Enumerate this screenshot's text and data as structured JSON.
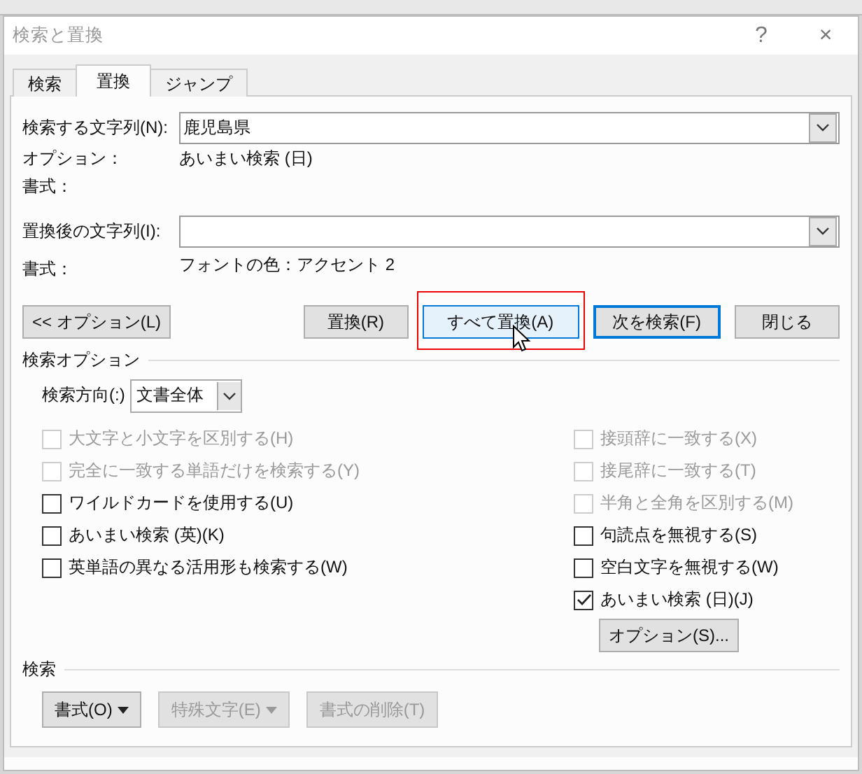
{
  "window": {
    "title": "検索と置換",
    "help": "?",
    "close": "×"
  },
  "tabs": [
    {
      "label": "検索",
      "selected": false
    },
    {
      "label": "置換",
      "selected": true
    },
    {
      "label": "ジャンプ",
      "selected": false
    }
  ],
  "find": {
    "label": "検索する文字列(N):",
    "value": "鹿児島県",
    "options_label": "オプション：",
    "options_value": "あいまい検索 (日)",
    "format_label": "書式："
  },
  "replace": {
    "label": "置換後の文字列(I):",
    "format_label": "書式：",
    "format_value": "フォントの色：アクセント 2"
  },
  "buttons": [
    {
      "label": "<< オプション(L)",
      "kind": "left",
      "focused": false,
      "hovered": false
    },
    {
      "label": "置換(R)",
      "kind": "right",
      "focused": false,
      "hovered": false
    },
    {
      "label": "すべて置換(A)",
      "kind": "right",
      "focused": false,
      "hovered": true
    },
    {
      "label": "次を検索(F)",
      "kind": "right",
      "focused": true,
      "hovered": false
    },
    {
      "label": "閉じる",
      "kind": "right",
      "focused": false,
      "hovered": false
    }
  ],
  "search_options": {
    "title": "検索オプション",
    "direction_label": "検索方向(:)",
    "direction_value": "文書全体",
    "left": [
      {
        "label": "大文字と小文字を区別する(H)",
        "checked": false,
        "disabled": true
      },
      {
        "label": "完全に一致する単語だけを検索する(Y)",
        "checked": false,
        "disabled": true
      },
      {
        "label": "ワイルドカードを使用する(U)",
        "checked": false,
        "disabled": false
      },
      {
        "label": "あいまい検索 (英)(K)",
        "checked": false,
        "disabled": false
      },
      {
        "label": "英単語の異なる活用形も検索する(W)",
        "checked": false,
        "disabled": false
      }
    ],
    "right": [
      {
        "label": "接頭辞に一致する(X)",
        "checked": false,
        "disabled": true
      },
      {
        "label": "接尾辞に一致する(T)",
        "checked": false,
        "disabled": true
      },
      {
        "label": "半角と全角を区別する(M)",
        "checked": false,
        "disabled": true
      },
      {
        "label": "句読点を無視する(S)",
        "checked": false,
        "disabled": false
      },
      {
        "label": "空白文字を無視する(W)",
        "checked": false,
        "disabled": false
      },
      {
        "label": "あいまい検索 (日)(J)",
        "checked": true,
        "disabled": false
      }
    ],
    "options_button": "オプション(S)..."
  },
  "search_section": {
    "title": "検索",
    "buttons": [
      {
        "label": "書式(O)",
        "kind": "menu",
        "disabled": false
      },
      {
        "label": "特殊文字(E)",
        "kind": "menu",
        "disabled": true
      },
      {
        "label": "書式の削除(T)",
        "kind": "plain",
        "disabled": true
      }
    ]
  }
}
